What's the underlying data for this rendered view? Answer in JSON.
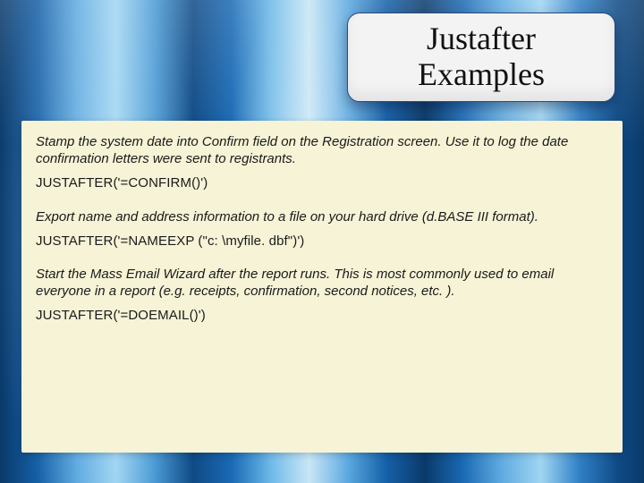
{
  "title": "Justafter Examples",
  "blocks": [
    {
      "desc": "Stamp the system date into Confirm field on the Registration screen.  Use it to log the date confirmation letters were sent to registrants.",
      "code": "JUSTAFTER('=CONFIRM()')"
    },
    {
      "desc": "Export name and address information to a file on your hard drive (d.BASE III format).",
      "code": "JUSTAFTER('=NAMEEXP (\"c: \\myfile. dbf\")')"
    },
    {
      "desc": "Start the Mass Email Wizard after the report runs.  This is most commonly used to email everyone in a report (e.g. receipts, confirmation, second notices, etc. ).",
      "code": "JUSTAFTER('=DOEMAIL()')"
    }
  ]
}
